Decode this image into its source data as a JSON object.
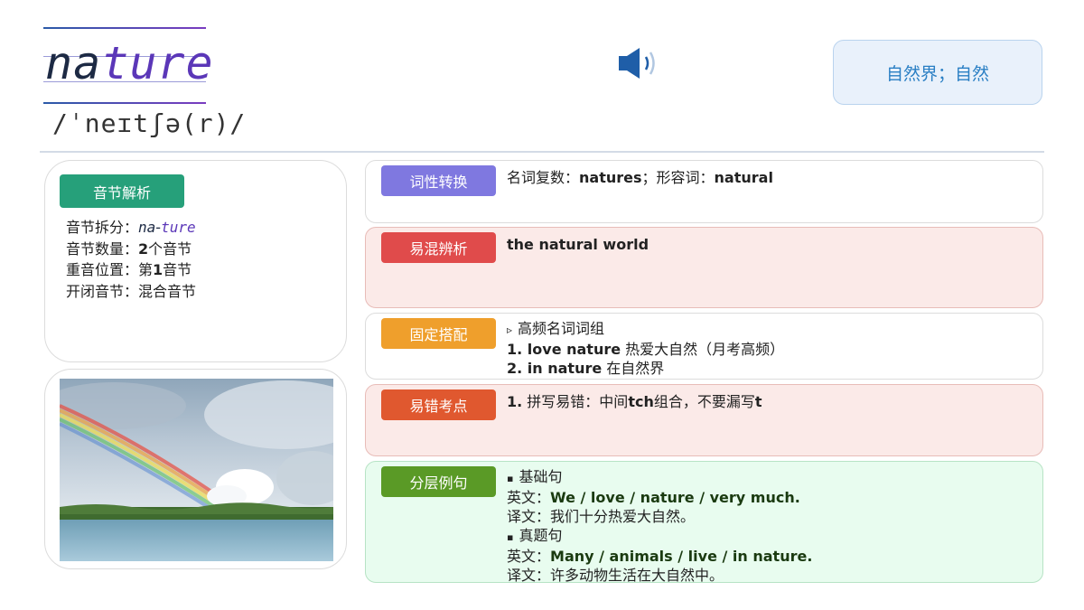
{
  "header": {
    "word_part1": "na",
    "word_part2": "ture",
    "phonetic": "/ˈneɪtʃə(r)/",
    "meaning": "自然界；自然"
  },
  "icons": {
    "speaker": "speaker-icon"
  },
  "colors": {
    "syllable_tag": "#26a07a",
    "pos_tag": "#7f78e0",
    "confusion_tag": "#e04b4b",
    "collocation_tag": "#ef9f2c",
    "error_tag": "#e0582f",
    "example_tag": "#5a9a26",
    "meaning_text": "#2a7fc4"
  },
  "syllable": {
    "tag": "音节解析",
    "split_label": "音节拆分：",
    "split_part1": "na",
    "split_dash": "-",
    "split_part2": "ture",
    "count_label": "音节数量：",
    "count_num": "2",
    "count_unit": "个音节",
    "stress_label": "重音位置：",
    "stress_prefix": "第",
    "stress_num": "1",
    "stress_unit": "音节",
    "type_label": "开闭音节：",
    "type_value": "混合音节"
  },
  "panels": {
    "pos": {
      "tag": "词性转换",
      "label1": "名词复数：",
      "value1": "natures",
      "sep": "；形容词：",
      "value2": "natural"
    },
    "confusion": {
      "tag": "易混辨析",
      "text": "the natural world"
    },
    "collocation": {
      "tag": "固定搭配",
      "bullet": "▹",
      "heading": "高频名词词组",
      "item1_en": "1. love nature",
      "item1_zh": " 热爱大自然（月考高频）",
      "item2_en": "2. in nature",
      "item2_zh": " 在自然界"
    },
    "errors": {
      "tag": "易错考点",
      "num": "1.",
      "text_a": " 拼写易错：中间",
      "text_b": "tch",
      "text_c": "组合，不要漏写",
      "text_d": "t"
    },
    "examples": {
      "tag": "分层例句",
      "bullet": "▪",
      "basic_title": "基础句",
      "en_label": "英文：",
      "basic_en": "We / love / nature / very much.",
      "zh_label": "译文：",
      "basic_zh": "我们十分热爱大自然。",
      "real_title": "真题句",
      "real_en": "Many / animals / live / in nature.",
      "real_zh": "许多动物生活在大自然中。"
    }
  }
}
